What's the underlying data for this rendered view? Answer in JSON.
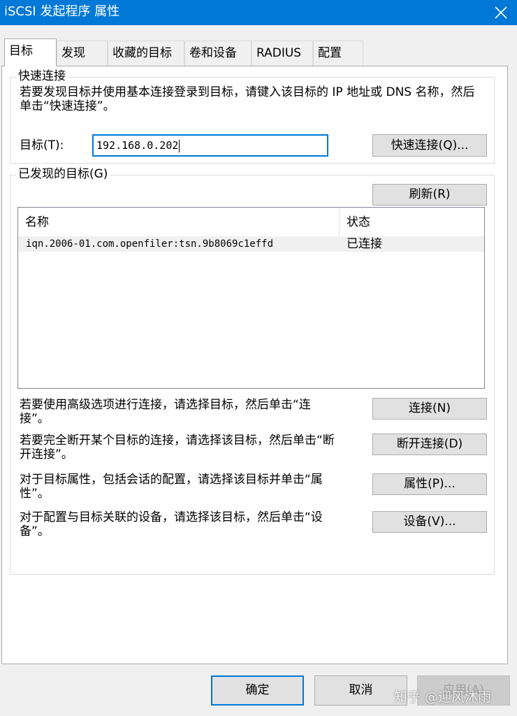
{
  "window": {
    "title": "iSCSI 发起程序 属性"
  },
  "tabs": [
    "目标",
    "发现",
    "收藏的目标",
    "卷和设备",
    "RADIUS",
    "配置"
  ],
  "quick_connect": {
    "legend": "快速连接",
    "description": "若要发现目标并使用基本连接登录到目标，请键入该目标的 IP 地址或 DNS 名称，然后单击“快速连接”。",
    "target_label": "目标(T):",
    "target_value": "192.168.0.202",
    "button": "快速连接(Q)..."
  },
  "discovered": {
    "legend": "已发现的目标(G)",
    "refresh_button": "刷新(R)",
    "columns": [
      "名称",
      "状态"
    ],
    "rows": [
      {
        "name": "iqn.2006-01.com.openfiler:tsn.9b8069c1effd",
        "status": "已连接"
      }
    ]
  },
  "actions": [
    {
      "text": "若要使用高级选项进行连接，请选择目标，然后单击“连接”。",
      "button": "连接(N)"
    },
    {
      "text": "若要完全断开某个目标的连接，请选择该目标，然后单击“断开连接”。",
      "button": "断开连接(D)"
    },
    {
      "text": "对于目标属性，包括会话的配置，请选择该目标并单击“属性”。",
      "button": "属性(P)..."
    },
    {
      "text": "对于配置与目标关联的设备，请选择该目标，然后单击“设备”。",
      "button": "设备(V)..."
    }
  ],
  "footer": {
    "ok": "确定",
    "cancel": "取消",
    "apply": "应用(A)"
  },
  "watermark": "知乎 @迎风沐雨",
  "colors": {
    "titlebar": "#0078d7",
    "focus_border": "#0078d7",
    "dialog_bg": "#f0f0f0"
  }
}
